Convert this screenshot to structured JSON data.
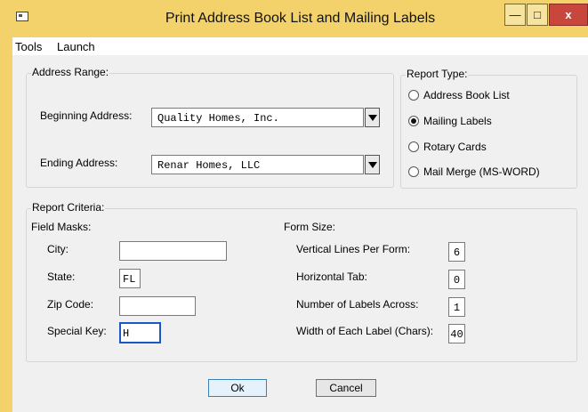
{
  "window": {
    "title": "Print Address Book List and Mailing Labels",
    "controls": {
      "minimize": "—",
      "maximize": "□",
      "close": "x"
    }
  },
  "menu": [
    "Tools",
    "Launch"
  ],
  "address_range": {
    "title": "Address Range:",
    "beginning_label": "Beginning Address:",
    "beginning_value": "Quality Homes, Inc.",
    "ending_label": "Ending Address:",
    "ending_value": "Renar Homes, LLC"
  },
  "report_type": {
    "title": "Report Type:",
    "options": [
      {
        "label": "Address Book List",
        "selected": false
      },
      {
        "label": "Mailing Labels",
        "selected": true
      },
      {
        "label": "Rotary Cards",
        "selected": false
      },
      {
        "label": "Mail Merge (MS-WORD)",
        "selected": false
      }
    ]
  },
  "report_criteria": {
    "title": "Report Criteria:",
    "field_masks": {
      "title": "Field Masks:",
      "city_label": "City:",
      "city_value": "",
      "state_label": "State:",
      "state_value": "FL",
      "zip_label": "Zip Code:",
      "zip_value": "",
      "special_label": "Special Key:",
      "special_value": "H"
    },
    "form_size": {
      "title": "Form Size:",
      "vlines_label": "Vertical Lines Per Form:",
      "vlines_value": "6",
      "htab_label": "Horizontal Tab:",
      "htab_value": "0",
      "across_label": "Number of Labels Across:",
      "across_value": "1",
      "width_label": "Width of Each Label (Chars):",
      "width_value": "40"
    }
  },
  "buttons": {
    "ok": "Ok",
    "cancel": "Cancel"
  }
}
